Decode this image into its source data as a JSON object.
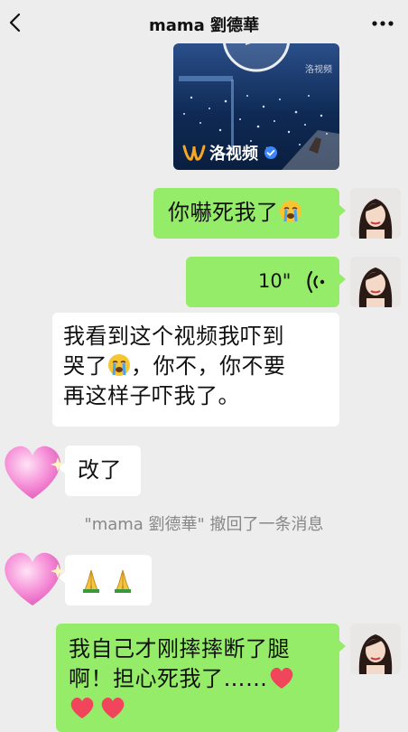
{
  "header": {
    "title": "mama 劉德華",
    "back_icon": "chevron-left-icon",
    "more_icon": "more-dots-icon"
  },
  "video_card": {
    "brand": "洛视频",
    "watermark": "洛视频"
  },
  "messages": [
    {
      "side": "right",
      "text": "你嚇死我了",
      "emoji": "crying-face"
    },
    {
      "side": "right",
      "voice_duration": "10\"",
      "icon": "voice-wave-icon"
    },
    {
      "side": "left",
      "line1": "我看到这个视频我吓到",
      "line2a": "哭了",
      "line2b": "，你不，你不要",
      "line3": "再这样子吓我了。",
      "emoji": "crying-face"
    },
    {
      "side": "left",
      "text": "改了"
    },
    {
      "side": "left",
      "emoji": "praying-hands"
    },
    {
      "side": "right",
      "line1": "我自己才刚摔摔断了腿",
      "line2": "啊！担心死我了……",
      "emoji": "red-heart"
    }
  ],
  "system_notice": "\"mama 劉德華\" 撤回了一条消息",
  "colors": {
    "background": "#ededed",
    "green_bubble": "#95ec69",
    "white_bubble": "#ffffff",
    "heart": "#f0455a"
  }
}
